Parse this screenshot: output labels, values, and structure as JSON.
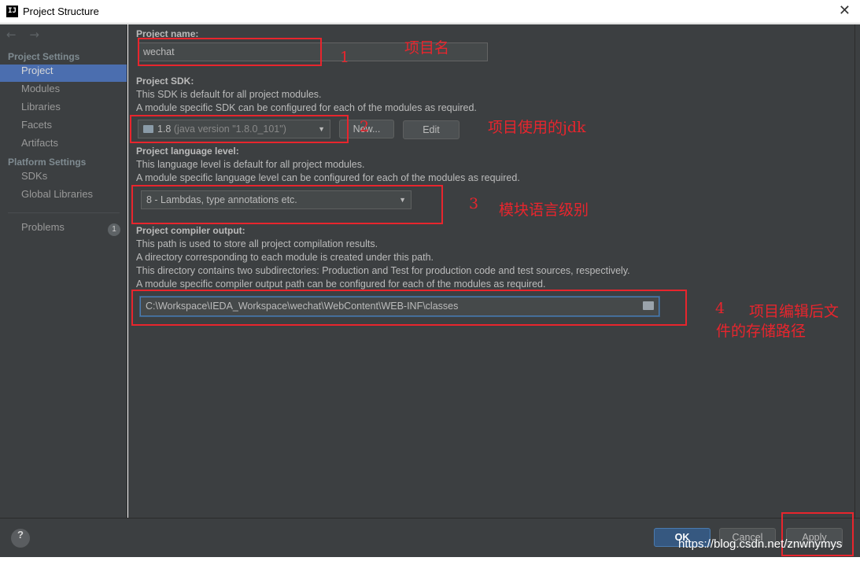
{
  "window": {
    "title": "Project Structure",
    "app_icon": "IJ",
    "close": "✕"
  },
  "sidebar": {
    "arrows": "← →",
    "project_settings_header": "Project Settings",
    "project_settings": [
      "Project",
      "Modules",
      "Libraries",
      "Facets",
      "Artifacts"
    ],
    "platform_settings_header": "Platform Settings",
    "platform_settings": [
      "SDKs",
      "Global Libraries"
    ],
    "problems": {
      "label": "Problems",
      "count": "1"
    },
    "selected": "Project"
  },
  "main": {
    "project_name": {
      "label": "Project name:",
      "value": "wechat"
    },
    "project_sdk": {
      "label": "Project SDK:",
      "desc1": "This SDK is default for all project modules.",
      "desc2": "A module specific SDK can be configured for each of the modules as required.",
      "selected": "1.8",
      "selected_detail": "(java version \"1.8.0_101\")",
      "new_button": "New...",
      "edit_button": "Edit"
    },
    "language_level": {
      "label": "Project language level:",
      "desc1": "This language level is default for all project modules.",
      "desc2": "A module specific language level can be configured for each of the modules as required.",
      "selected": "8 - Lambdas, type annotations etc."
    },
    "compiler_output": {
      "label": "Project compiler output:",
      "desc1": "This path is used to store all project compilation results.",
      "desc2": "A directory corresponding to each module is created under this path.",
      "desc3": "This directory contains two subdirectories: Production and Test for production code and test sources, respectively.",
      "desc4": "A module specific compiler output path can be configured for each of the modules as required.",
      "value": "C:\\Workspace\\IEDA_Workspace\\wechat\\WebContent\\WEB-INF\\classes"
    }
  },
  "footer": {
    "help": "?",
    "ok": "OK",
    "cancel": "Cancel",
    "apply": "Apply"
  },
  "annotations": {
    "n1": "1",
    "t1": "项目名",
    "n2": "2",
    "t2": "项目使用的jdk",
    "n3": "3",
    "t3": "模块语言级别",
    "n4": "4",
    "t4a": "项目编辑后文",
    "t4b": "件的存储路径"
  },
  "watermark": "https://blog.csdn.net/znwnymys",
  "colors": {
    "accent": "#4b6eaf",
    "annotation": "#e8252d",
    "background": "#3c3f41"
  }
}
